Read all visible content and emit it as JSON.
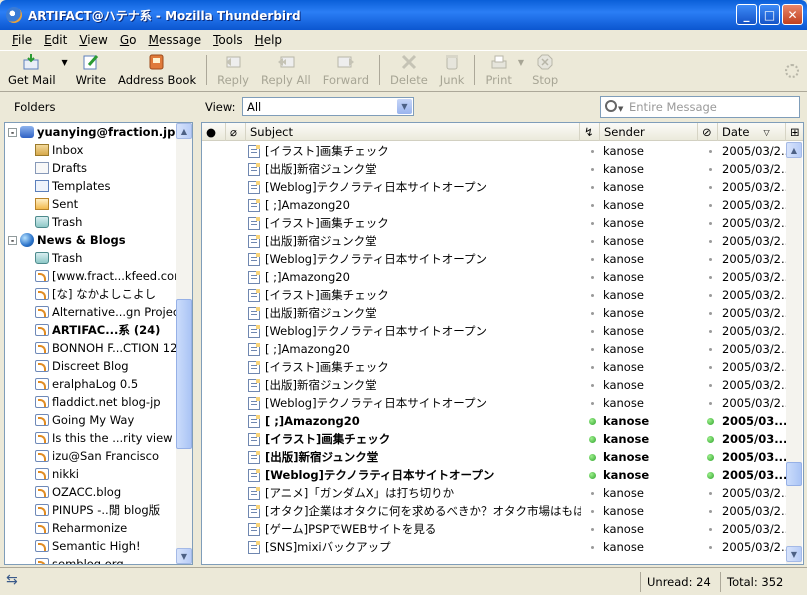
{
  "window": {
    "title": "ARTIFACT@ハテナ系 - Mozilla Thunderbird",
    "buttons": [
      "_",
      "□",
      "✕"
    ]
  },
  "menu": [
    "File",
    "Edit",
    "View",
    "Go",
    "Message",
    "Tools",
    "Help"
  ],
  "menu_access_keys": [
    "F",
    "E",
    "V",
    "G",
    "M",
    "T",
    "H"
  ],
  "toolbar": {
    "get_mail": "Get Mail",
    "write": "Write",
    "address_book": "Address Book",
    "reply": "Reply",
    "reply_all": "Reply All",
    "forward": "Forward",
    "delete": "Delete",
    "junk": "Junk",
    "print": "Print",
    "stop": "Stop"
  },
  "folders_label": "Folders",
  "view": {
    "label": "View:",
    "value": "All"
  },
  "search": {
    "placeholder": "Entire Message"
  },
  "folders": [
    {
      "label": "yuanying@fraction.jp",
      "icon": "account-icon",
      "level": 0,
      "bold": true,
      "expander": "-"
    },
    {
      "label": "Inbox",
      "icon": "inbox-icon",
      "level": 1
    },
    {
      "label": "Drafts",
      "icon": "drafts-icon",
      "level": 1
    },
    {
      "label": "Templates",
      "icon": "templates-icon",
      "level": 1
    },
    {
      "label": "Sent",
      "icon": "sent-icon",
      "level": 1
    },
    {
      "label": "Trash",
      "icon": "trash-icon",
      "level": 1
    },
    {
      "label": "News & Blogs",
      "icon": "globe-icon",
      "level": 0,
      "bold": true,
      "expander": "-"
    },
    {
      "label": "Trash",
      "icon": "trash-icon",
      "level": 1
    },
    {
      "label": "[www.fract...kfeed.com",
      "icon": "feed-icon",
      "level": 1
    },
    {
      "label": "[な] なかよしこよし",
      "icon": "feed-icon",
      "level": 1
    },
    {
      "label": "Alternative...gn Project",
      "icon": "feed-icon",
      "level": 1
    },
    {
      "label": "ARTIFAC...系 (24)",
      "icon": "feed-icon",
      "level": 1,
      "bold": true
    },
    {
      "label": "BONNOH F...CTION 12",
      "icon": "feed-icon",
      "level": 1
    },
    {
      "label": "Discreet Blog",
      "icon": "feed-icon",
      "level": 1
    },
    {
      "label": "eralphaLog 0.5",
      "icon": "feed-icon",
      "level": 1
    },
    {
      "label": "fladdict.net blog-jp",
      "icon": "feed-icon",
      "level": 1
    },
    {
      "label": "Going My Way",
      "icon": "feed-icon",
      "level": 1
    },
    {
      "label": "Is this the ...rity view ?",
      "icon": "feed-icon",
      "level": 1
    },
    {
      "label": "izu@San Francisco",
      "icon": "feed-icon",
      "level": 1
    },
    {
      "label": "nikki",
      "icon": "feed-icon",
      "level": 1
    },
    {
      "label": "OZACC.blog",
      "icon": "feed-icon",
      "level": 1
    },
    {
      "label": "PINUPS -..閒 blog版",
      "icon": "feed-icon",
      "level": 1
    },
    {
      "label": "Reharmonize",
      "icon": "feed-icon",
      "level": 1
    },
    {
      "label": "Semantic High!",
      "icon": "feed-icon",
      "level": 1
    },
    {
      "label": "semblog.org",
      "icon": "feed-icon",
      "level": 1
    }
  ],
  "columns": {
    "subject": "Subject",
    "sender": "Sender",
    "date": "Date"
  },
  "messages": [
    {
      "subject": "[イラスト]画集チェック",
      "sender": "kanose",
      "date": "2005/03/2...",
      "unread": false
    },
    {
      "subject": "[出版]新宿ジュンク堂",
      "sender": "kanose",
      "date": "2005/03/2...",
      "unread": false
    },
    {
      "subject": "[Weblog]テクノラティ日本サイトオープン",
      "sender": "kanose",
      "date": "2005/03/2...",
      "unread": false
    },
    {
      "subject": "[ ;]Amazong20",
      "sender": "kanose",
      "date": "2005/03/2...",
      "unread": false
    },
    {
      "subject": "[イラスト]画集チェック",
      "sender": "kanose",
      "date": "2005/03/2...",
      "unread": false
    },
    {
      "subject": "[出版]新宿ジュンク堂",
      "sender": "kanose",
      "date": "2005/03/2...",
      "unread": false
    },
    {
      "subject": "[Weblog]テクノラティ日本サイトオープン",
      "sender": "kanose",
      "date": "2005/03/2...",
      "unread": false
    },
    {
      "subject": "[ ;]Amazong20",
      "sender": "kanose",
      "date": "2005/03/2...",
      "unread": false
    },
    {
      "subject": "[イラスト]画集チェック",
      "sender": "kanose",
      "date": "2005/03/2...",
      "unread": false
    },
    {
      "subject": "[出版]新宿ジュンク堂",
      "sender": "kanose",
      "date": "2005/03/2...",
      "unread": false
    },
    {
      "subject": "[Weblog]テクノラティ日本サイトオープン",
      "sender": "kanose",
      "date": "2005/03/2...",
      "unread": false
    },
    {
      "subject": "[ ;]Amazong20",
      "sender": "kanose",
      "date": "2005/03/2...",
      "unread": false
    },
    {
      "subject": "[イラスト]画集チェック",
      "sender": "kanose",
      "date": "2005/03/2...",
      "unread": false
    },
    {
      "subject": "[出版]新宿ジュンク堂",
      "sender": "kanose",
      "date": "2005/03/2...",
      "unread": false
    },
    {
      "subject": "[Weblog]テクノラティ日本サイトオープン",
      "sender": "kanose",
      "date": "2005/03/2...",
      "unread": false
    },
    {
      "subject": "[ ;]Amazong20",
      "sender": "kanose",
      "date": "2005/03...",
      "unread": true
    },
    {
      "subject": "[イラスト]画集チェック",
      "sender": "kanose",
      "date": "2005/03...",
      "unread": true
    },
    {
      "subject": "[出版]新宿ジュンク堂",
      "sender": "kanose",
      "date": "2005/03...",
      "unread": true
    },
    {
      "subject": "[Weblog]テクノラティ日本サイトオープン",
      "sender": "kanose",
      "date": "2005/03...",
      "unread": true
    },
    {
      "subject": "[アニメ]「ガンダムX」は打ち切りか",
      "sender": "kanose",
      "date": "2005/03/2...",
      "unread": false
    },
    {
      "subject": "[オタク]企業はオタクに何を求めるべきか？オタク市場はもはやニッチ...",
      "sender": "kanose",
      "date": "2005/03/2...",
      "unread": false
    },
    {
      "subject": "[ゲーム]PSPでWEBサイトを見る",
      "sender": "kanose",
      "date": "2005/03/2...",
      "unread": false
    },
    {
      "subject": "[SNS]mixiバックアップ",
      "sender": "kanose",
      "date": "2005/03/2...",
      "unread": false
    }
  ],
  "status": {
    "unread": "Unread: 24",
    "total": "Total: 352"
  }
}
